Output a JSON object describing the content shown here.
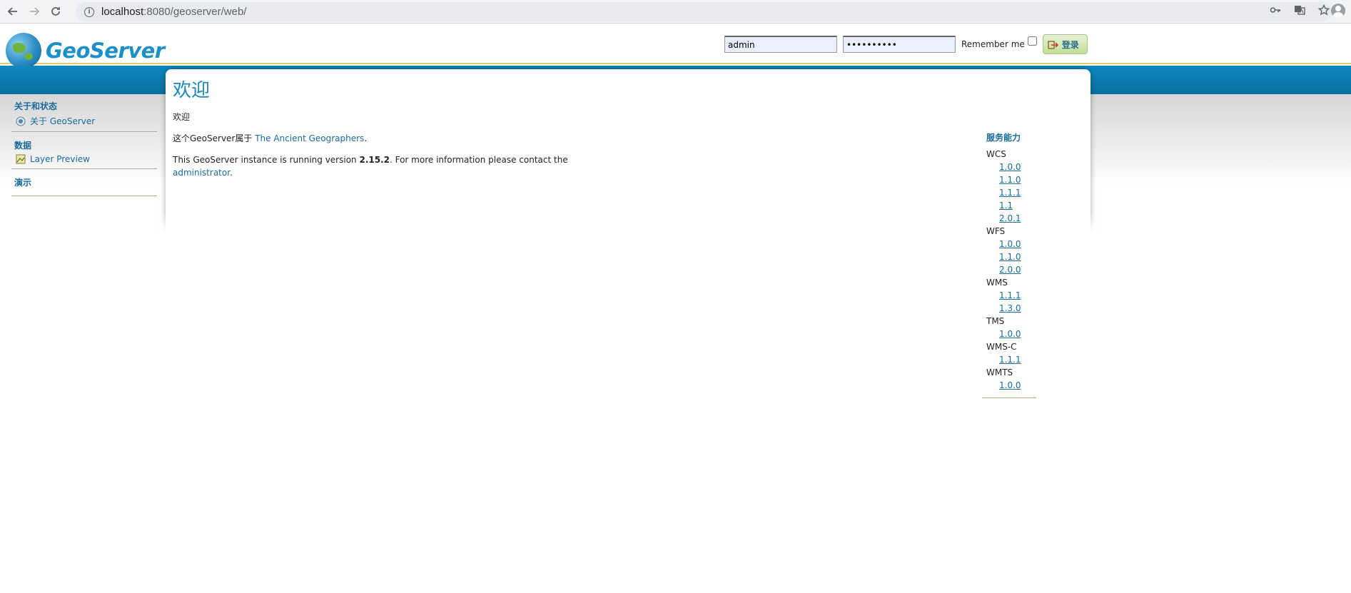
{
  "browser": {
    "url_host": "localhost",
    "url_path": ":8080/geoserver/web/"
  },
  "header": {
    "brand": "GeoServer",
    "username_value": "admin",
    "password_value": "••••••••••",
    "remember_label": "Remember me",
    "login_label": "登录"
  },
  "sidebar": {
    "sections": [
      {
        "heading": "关于和状态",
        "items": [
          {
            "label": "关于 GeoServer",
            "icon": "about-icon"
          }
        ]
      },
      {
        "heading": "数据",
        "items": [
          {
            "label": "Layer Preview",
            "icon": "layer-preview-icon"
          }
        ]
      },
      {
        "heading": "演示",
        "items": []
      }
    ]
  },
  "main": {
    "title": "欢迎",
    "subtitle": "欢迎",
    "owner_prefix": "这个GeoServer属于 ",
    "owner_link": "The Ancient Geographers",
    "owner_suffix": ".",
    "version_prefix": "This GeoServer instance is running version ",
    "version": "2.15.2",
    "version_suffix": ". For more information please contact the",
    "admin_link": "administrator",
    "admin_suffix": "."
  },
  "capabilities": {
    "title": "服务能力",
    "services": [
      {
        "name": "WCS",
        "versions": [
          "1.0.0",
          "1.1.0",
          "1.1.1",
          "1.1",
          "2.0.1"
        ]
      },
      {
        "name": "WFS",
        "versions": [
          "1.0.0",
          "1.1.0",
          "2.0.0"
        ]
      },
      {
        "name": "WMS",
        "versions": [
          "1.1.1",
          "1.3.0"
        ]
      },
      {
        "name": "TMS",
        "versions": [
          "1.0.0"
        ]
      },
      {
        "name": "WMS-C",
        "versions": [
          "1.1.1"
        ]
      },
      {
        "name": "WMTS",
        "versions": [
          "1.0.0"
        ]
      }
    ]
  }
}
